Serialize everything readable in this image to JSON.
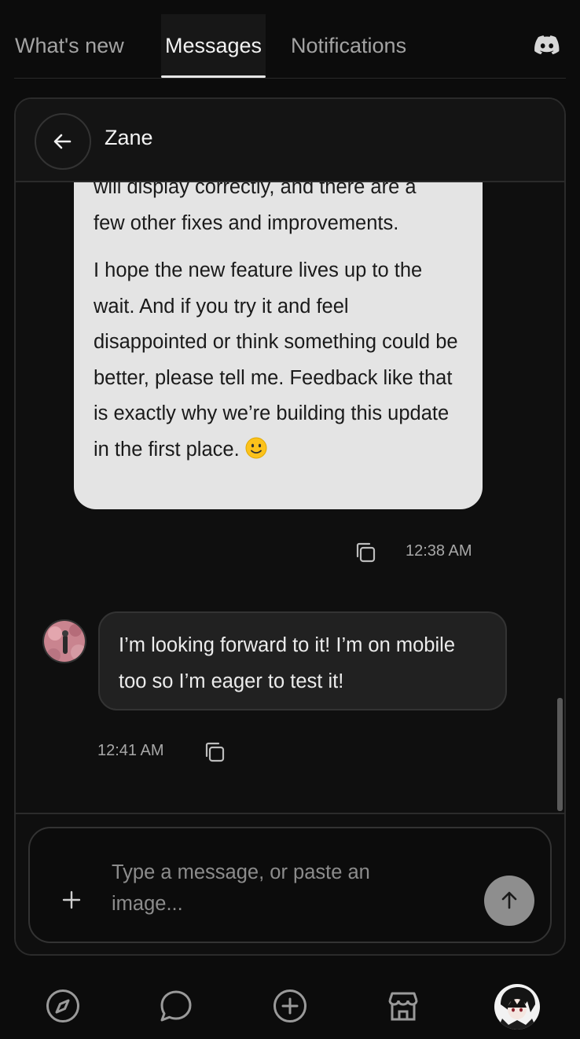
{
  "tabs": {
    "whats_new": "What's new",
    "messages": "Messages",
    "notifications": "Notifications",
    "active": "Messages"
  },
  "chat": {
    "contact_name": "Zane",
    "outgoing": {
      "partial_line": "will display correctly, and there are a",
      "para1": "few other fixes and improvements.",
      "para2": "I hope the new feature lives up to the wait. And if you try it and feel disappointed or think something could be better, please tell me. Feedback like that is exactly why we’re building this update in the first place.",
      "emoji": "slightly-smiling-face",
      "time": "12:38 AM"
    },
    "incoming": {
      "text": "I’m looking forward to it! I’m on mobile too so I’m eager to test it!",
      "time": "12:41 AM"
    }
  },
  "composer": {
    "placeholder": "Type a message, or paste an image..."
  },
  "bottom_nav": {
    "items": [
      "compass-icon",
      "chat-bubble-icon",
      "plus-circle-icon",
      "store-icon",
      "profile-avatar"
    ]
  },
  "colors": {
    "background": "#0c0c0c",
    "outgoing_bubble": "#e4e4e4",
    "incoming_bubble": "#212121",
    "send_button": "#8e8e8e"
  }
}
